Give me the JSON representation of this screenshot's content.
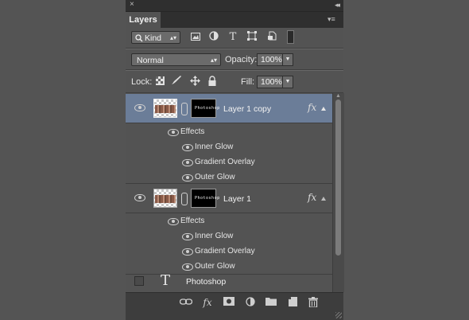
{
  "panel": {
    "tab_label": "Layers",
    "close_glyph": "×",
    "collapse_glyph": "◂◂",
    "menu_glyph": "▾≡"
  },
  "filter": {
    "kind_label": "Kind",
    "kind_icon": "search-icon",
    "filter_icons": [
      "image-filter-icon",
      "adjustment-filter-icon",
      "type-filter-icon",
      "shape-filter-icon",
      "smart-object-filter-icon",
      "filter-toggle-icon"
    ]
  },
  "blend": {
    "mode": "Normal",
    "opacity_label": "Opacity:",
    "opacity_value": "100%"
  },
  "lock": {
    "label": "Lock:",
    "icons": [
      "lock-transparent-pixels-icon",
      "lock-image-pixels-icon",
      "lock-position-icon",
      "lock-all-icon"
    ],
    "fill_label": "Fill:",
    "fill_value": "100%"
  },
  "layers": [
    {
      "name": "Layer 1 copy",
      "selected": true,
      "visible": true,
      "fx": "fx",
      "mask_text": "Photoshop",
      "effects_label": "Effects",
      "effects": [
        "Inner Glow",
        "Gradient Overlay",
        "Outer Glow"
      ]
    },
    {
      "name": "Layer 1",
      "selected": false,
      "visible": true,
      "fx": "fx",
      "mask_text": "Photoshop",
      "effects_label": "Effects",
      "effects": [
        "Inner Glow",
        "Gradient Overlay",
        "Outer Glow"
      ]
    },
    {
      "name": "Photoshop",
      "type_glyph": "T",
      "visible": false
    }
  ],
  "footer": {
    "icons": [
      "link-layers-icon",
      "add-layer-style-icon",
      "add-mask-icon",
      "new-adjustment-layer-icon",
      "new-group-icon",
      "new-layer-icon",
      "delete-layer-icon"
    ],
    "fx_glyph": "fx"
  },
  "colors": {
    "panel_bg": "#535353",
    "selected_row": "#6b7d98",
    "background": "#545454"
  }
}
